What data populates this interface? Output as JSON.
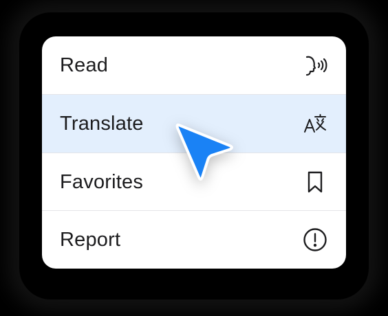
{
  "menu": {
    "items": [
      {
        "label": "Read",
        "icon": "speak-icon",
        "selected": false
      },
      {
        "label": "Translate",
        "icon": "translate-icon",
        "selected": true
      },
      {
        "label": "Favorites",
        "icon": "bookmark-icon",
        "selected": false
      },
      {
        "label": "Report",
        "icon": "exclamation-circle-icon",
        "selected": false
      }
    ]
  },
  "colors": {
    "menu_background": "#ffffff",
    "selected_background": "#e3effd",
    "text": "#1c1c1e",
    "cursor": "#1a82f5",
    "divider": "#e4e4e8"
  },
  "cursor": {
    "icon": "pointer-arrow-icon"
  }
}
